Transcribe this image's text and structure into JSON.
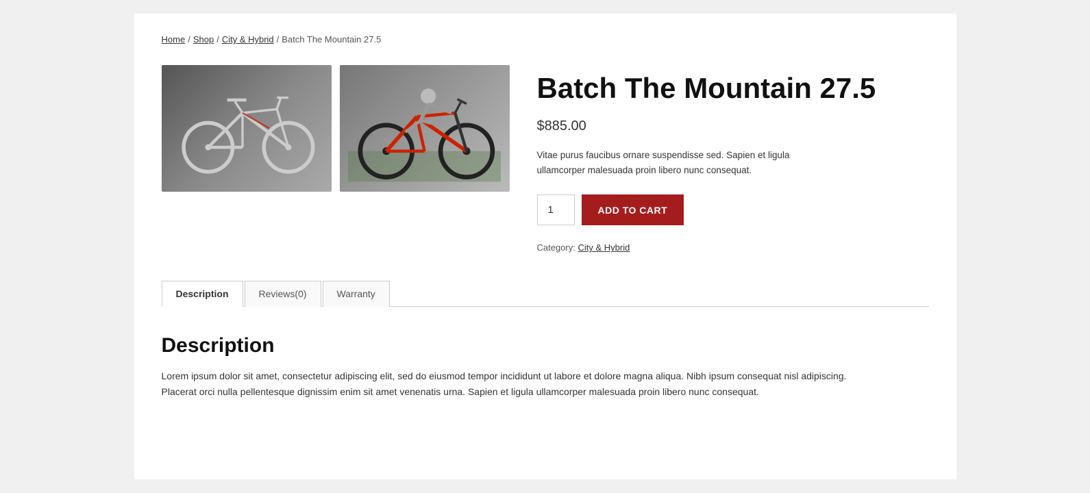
{
  "breadcrumb": {
    "home": "Home",
    "shop": "Shop",
    "category": "City & Hybrid",
    "current": "Batch The Mountain 27.5"
  },
  "product": {
    "title": "Batch The Mountain 27.5",
    "price": "$885.00",
    "short_description": "Vitae purus faucibus ornare suspendisse sed. Sapien et ligula ullamcorper malesuada proin libero nunc consequat.",
    "quantity": "1",
    "add_to_cart_label": "ADD TO CART",
    "category_label": "Category:",
    "category_link": "City & Hybrid"
  },
  "tabs": {
    "description_label": "Description",
    "reviews_label": "Reviews(0)",
    "warranty_label": "Warranty"
  },
  "description_section": {
    "heading": "Description",
    "body": "Lorem ipsum dolor sit amet, consectetur adipiscing elit, sed do eiusmod tempor incididunt ut labore et dolore magna aliqua. Nibh ipsum consequat nisl adipiscing. Placerat orci nulla pellentesque dignissim enim sit amet venenatis urna. Sapien et ligula ullamcorper malesuada proin libero nunc consequat."
  },
  "colors": {
    "add_to_cart_bg": "#a51c1c",
    "category_link": "#333",
    "price_color": "#333"
  }
}
